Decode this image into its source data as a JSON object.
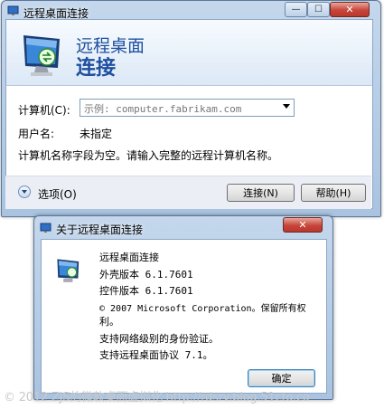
{
  "main_window": {
    "title": "远程桌面连接",
    "controls": {
      "minimize": "—",
      "maximize": "☐",
      "close": "✕"
    },
    "heading_line1": "远程桌面",
    "heading_line2": "连接",
    "computer_label": "计算机(C):",
    "computer_placeholder": "示例: computer.fabrikam.com",
    "username_label": "用户名:",
    "username_value": "未指定",
    "message": "计算机名称字段为空。请输入完整的远程计算机名称。",
    "options_label": "选项(O)",
    "connect_button": "连接(N)",
    "help_button": "帮助(H)"
  },
  "about_dialog": {
    "title": "关于远程桌面连接",
    "close": "✕",
    "lines": [
      "远程桌面连接",
      "外壳版本 6.1.7601",
      "控件版本 6.1.7601",
      "© 2007 Microsoft Corporation。保留所有权",
      "利。",
      "支持网络级别的身份验证。",
      "支持远程桌面协议 7.1。"
    ],
    "ok_button": "确定"
  },
  "watermark": "© 2012 ZJS的微软桌面虚拟化 http://rdsrv.blog.51cto.co",
  "icons": [
    "remote-desktop-icon",
    "monitor-icon",
    "chevron-down-icon",
    "close-icon"
  ],
  "colors": {
    "heading_blue": "#1e4fa0",
    "titlebar": "#b6cde6",
    "close_red": "#c6453a"
  }
}
